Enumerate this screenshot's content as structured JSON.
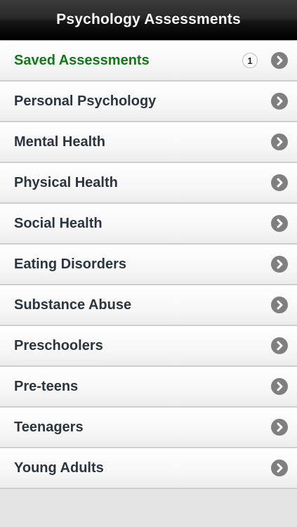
{
  "nav": {
    "title": "Psychology Assessments"
  },
  "list": {
    "items": [
      {
        "label": "Saved Assessments",
        "badge": "1",
        "highlight_color": "#0f7a16"
      },
      {
        "label": "Personal Psychology"
      },
      {
        "label": "Mental Health"
      },
      {
        "label": "Physical Health"
      },
      {
        "label": "Social Health"
      },
      {
        "label": "Eating Disorders"
      },
      {
        "label": "Substance Abuse"
      },
      {
        "label": "Preschoolers"
      },
      {
        "label": "Pre-teens"
      },
      {
        "label": "Teenagers"
      },
      {
        "label": "Young Adults"
      }
    ],
    "disclosure_icon": "chevron-right-icon"
  }
}
